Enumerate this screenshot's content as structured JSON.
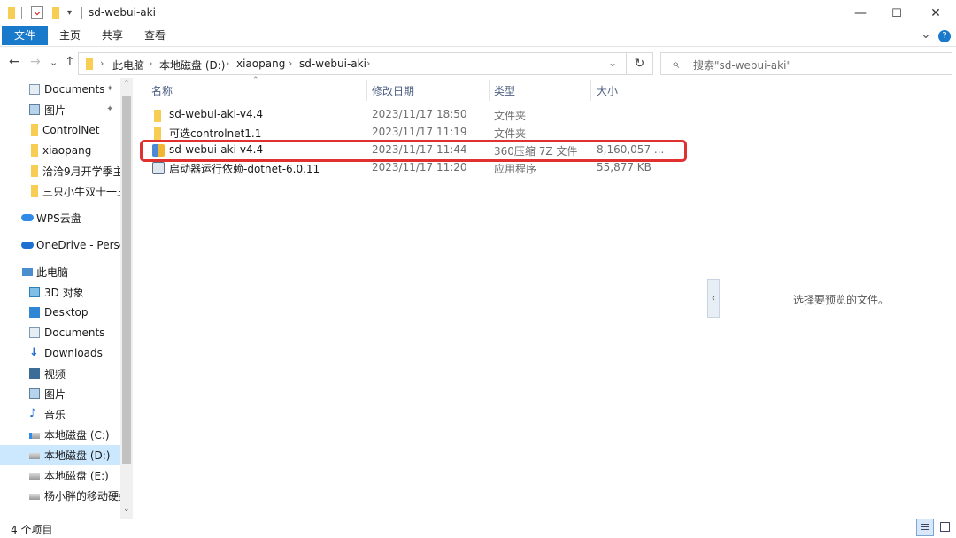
{
  "window": {
    "title": "sd-webui-aki",
    "minimize": "—",
    "maximize": "☐",
    "close": "✕"
  },
  "ribbon": {
    "tabs": [
      "文件",
      "主页",
      "共享",
      "查看"
    ],
    "expand": "⌄",
    "help": "?"
  },
  "nav": {
    "back": "←",
    "forward": "→",
    "recent": "⌄",
    "up": "↑",
    "breadcrumbs": [
      "此电脑",
      "本地磁盘 (D:)",
      "xiaopang",
      "sd-webui-aki"
    ],
    "dropdown": "⌄",
    "refresh": "↻",
    "search_placeholder": "搜索\"sd-webui-aki\"",
    "search_icon": "⌕"
  },
  "sidebar": {
    "items": [
      {
        "label": "Documents",
        "icon": "documents-icon",
        "pinned": true
      },
      {
        "label": "图片",
        "icon": "pictures-icon",
        "pinned": true
      },
      {
        "label": "ControlNet",
        "icon": "folder-icon"
      },
      {
        "label": "xiaopang",
        "icon": "folder-icon"
      },
      {
        "label": "洽洽9月开学季主",
        "icon": "folder-icon"
      },
      {
        "label": "三只小牛双十一三",
        "icon": "folder-icon"
      },
      {
        "label": "WPS云盘",
        "icon": "cloud-icon"
      },
      {
        "label": "OneDrive - Persc",
        "icon": "onedrive-icon"
      },
      {
        "label": "此电脑",
        "icon": "pc-icon"
      },
      {
        "label": "3D 对象",
        "icon": "3d-objects-icon"
      },
      {
        "label": "Desktop",
        "icon": "desktop-icon"
      },
      {
        "label": "Documents",
        "icon": "documents-icon"
      },
      {
        "label": "Downloads",
        "icon": "downloads-icon"
      },
      {
        "label": "视频",
        "icon": "videos-icon"
      },
      {
        "label": "图片",
        "icon": "pictures-icon"
      },
      {
        "label": "音乐",
        "icon": "music-icon"
      },
      {
        "label": "本地磁盘 (C:)",
        "icon": "drive-c-icon"
      },
      {
        "label": "本地磁盘 (D:)",
        "icon": "drive-d-icon",
        "selected": true
      },
      {
        "label": "本地磁盘 (E:)",
        "icon": "drive-e-icon"
      },
      {
        "label": "杨小胖的移动硬盘",
        "icon": "usb-drive-icon"
      }
    ],
    "pin_glyph": "📌",
    "scroll_up": "⌃",
    "scroll_down": "⌄"
  },
  "columns": {
    "name": "名称",
    "modified": "修改日期",
    "type": "类型",
    "size": "大小",
    "sort_indicator": "⌃"
  },
  "files": [
    {
      "name": "sd-webui-aki-v4.4",
      "modified": "2023/11/17 18:50",
      "type": "文件夹",
      "size": "",
      "icon": "folder-icon"
    },
    {
      "name": "可选controlnet1.1",
      "modified": "2023/11/17 11:19",
      "type": "文件夹",
      "size": "",
      "icon": "folder-icon"
    },
    {
      "name": "sd-webui-aki-v4.4",
      "modified": "2023/11/17 11:44",
      "type": "360压缩 7Z 文件",
      "size": "8,160,057 ...",
      "icon": "archive-icon",
      "highlighted": true
    },
    {
      "name": "启动器运行依赖-dotnet-6.0.11",
      "modified": "2023/11/17 11:20",
      "type": "应用程序",
      "size": "55,877 KB",
      "icon": "installer-icon"
    }
  ],
  "preview": {
    "toggle": "‹",
    "message": "选择要预览的文件。"
  },
  "status": {
    "item_count": "4 个项目"
  },
  "colors": {
    "file_tab": "#1979ca",
    "highlight": "#e03030",
    "selected": "#cce8ff",
    "folder": "#f7cd53"
  }
}
